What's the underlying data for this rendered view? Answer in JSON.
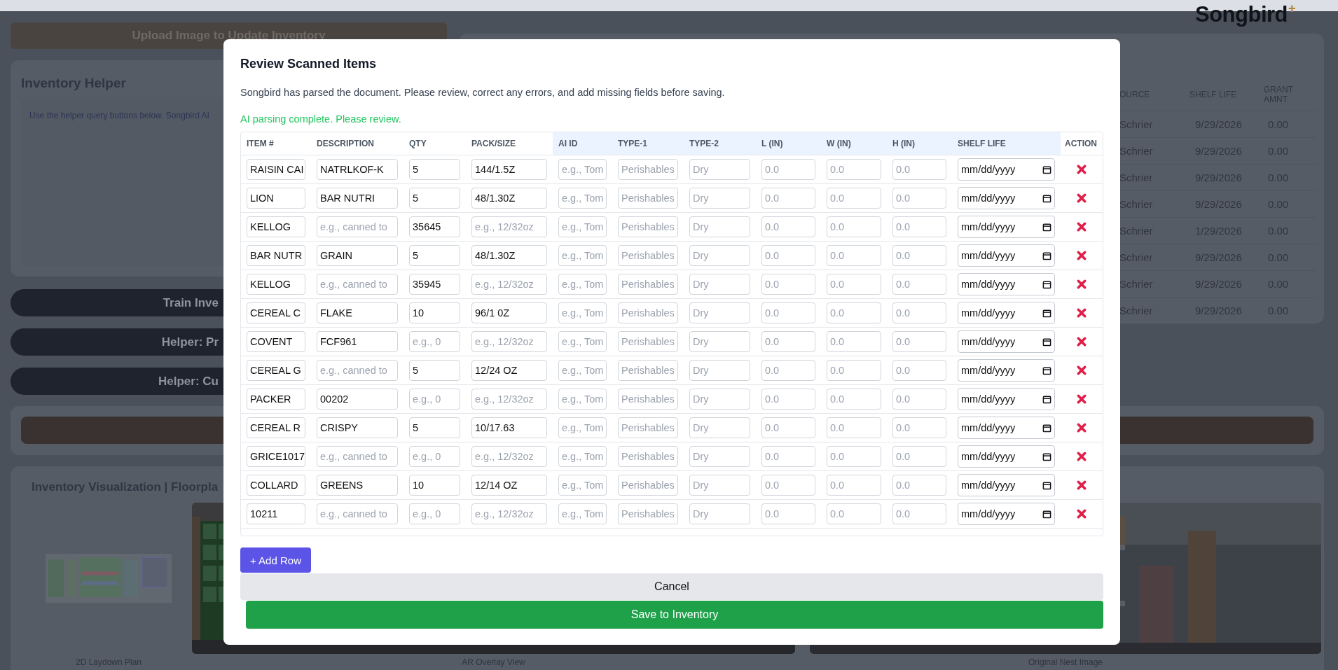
{
  "header": {
    "logo": "Songbird",
    "logo_mark": "+"
  },
  "upload_button": "Upload Image to Update Inventory",
  "helper": {
    "title": "Inventory Helper",
    "text": "Use the helper query buttons below. Songbird AI"
  },
  "helper_buttons": [
    "Train Inve",
    "Helper: Pr",
    "Helper: Cu"
  ],
  "inventory_table": {
    "columns": [
      "OURCE",
      "SHELF LIFE",
      "GRANT AMNT"
    ],
    "rows": [
      [
        "Schrier",
        "9/29/2026",
        "0.00"
      ],
      [
        "Schrier",
        "9/29/2026",
        "0.00"
      ],
      [
        "Schrier",
        "9/29/2026",
        "0.00"
      ],
      [
        "Schrier",
        "9/29/2026",
        "0.00"
      ],
      [
        "Schrier",
        "1/29/2026",
        "0.00"
      ],
      [
        "Schrier",
        "9/29/2026",
        "0.00"
      ],
      [
        "Schrier",
        "9/29/2026",
        "0.00"
      ],
      [
        "Schrier",
        "9/29/2026",
        "0.00"
      ]
    ]
  },
  "visualization": {
    "title": "Inventory Visualization | Floorpla",
    "panels": [
      {
        "kind": "plan",
        "caption": "2D Laydown Plan"
      },
      {
        "kind": "overlay",
        "caption": "AR Overlay View"
      },
      {
        "caption": "Original Nest Image"
      }
    ]
  },
  "modal": {
    "title": "Review Scanned Items",
    "description": "Songbird has parsed the document. Please review, correct any errors, and add missing fields before saving.",
    "status": "AI parsing complete. Please review.",
    "columns": [
      {
        "label": "ITEM #",
        "kind": "text",
        "highlighted": false
      },
      {
        "label": "DESCRIPTION",
        "kind": "text",
        "highlighted": false
      },
      {
        "label": "QTY",
        "kind": "text",
        "highlighted": false
      },
      {
        "label": "PACK/SIZE",
        "kind": "text",
        "highlighted": false
      },
      {
        "label": "AI ID",
        "kind": "text",
        "highlighted": true
      },
      {
        "label": "TYPE-1",
        "kind": "text",
        "highlighted": true
      },
      {
        "label": "TYPE-2",
        "kind": "text",
        "highlighted": true
      },
      {
        "label": "L (IN)",
        "kind": "text",
        "highlighted": true
      },
      {
        "label": "W (IN)",
        "kind": "text",
        "highlighted": true
      },
      {
        "label": "H (IN)",
        "kind": "text",
        "highlighted": true
      },
      {
        "label": "SHELF LIFE",
        "kind": "date",
        "highlighted": true
      },
      {
        "label": "ACTION",
        "kind": "action",
        "highlighted": false
      }
    ],
    "rows": [
      {
        "cells": [
          {
            "value": "RAISIN CAI"
          },
          {
            "value": "NATRLKOF-K"
          },
          {
            "value": "5"
          },
          {
            "value": "144/1.5Z"
          },
          {
            "placeholder": "e.g., Tom"
          },
          {
            "placeholder": "Perishables"
          },
          {
            "placeholder": "Dry"
          },
          {
            "placeholder": "0.0"
          },
          {
            "placeholder": "0.0"
          },
          {
            "placeholder": "0.0"
          },
          {
            "value": "mm/dd/yyyy"
          }
        ]
      },
      {
        "cells": [
          {
            "value": "LION"
          },
          {
            "value": "BAR NUTRI"
          },
          {
            "value": "5"
          },
          {
            "value": "48/1.30Z"
          },
          {
            "placeholder": "e.g., Tom"
          },
          {
            "placeholder": "Perishables"
          },
          {
            "placeholder": "Dry"
          },
          {
            "placeholder": "0.0"
          },
          {
            "placeholder": "0.0"
          },
          {
            "placeholder": "0.0"
          },
          {
            "value": "mm/dd/yyyy"
          }
        ]
      },
      {
        "cells": [
          {
            "value": "KELLOG"
          },
          {
            "placeholder": "e.g., canned to"
          },
          {
            "value": "35645"
          },
          {
            "placeholder": "e.g., 12/32oz"
          },
          {
            "placeholder": "e.g., Tom"
          },
          {
            "placeholder": "Perishables"
          },
          {
            "placeholder": "Dry"
          },
          {
            "placeholder": "0.0"
          },
          {
            "placeholder": "0.0"
          },
          {
            "placeholder": "0.0"
          },
          {
            "value": "mm/dd/yyyy"
          }
        ]
      },
      {
        "cells": [
          {
            "value": "BAR NUTR"
          },
          {
            "value": "GRAIN"
          },
          {
            "value": "5"
          },
          {
            "value": "48/1.30Z"
          },
          {
            "placeholder": "e.g., Tom"
          },
          {
            "placeholder": "Perishables"
          },
          {
            "placeholder": "Dry"
          },
          {
            "placeholder": "0.0"
          },
          {
            "placeholder": "0.0"
          },
          {
            "placeholder": "0.0"
          },
          {
            "value": "mm/dd/yyyy"
          }
        ]
      },
      {
        "cells": [
          {
            "value": "KELLOG"
          },
          {
            "placeholder": "e.g., canned to"
          },
          {
            "value": "35945"
          },
          {
            "placeholder": "e.g., 12/32oz"
          },
          {
            "placeholder": "e.g., Tom"
          },
          {
            "placeholder": "Perishables"
          },
          {
            "placeholder": "Dry"
          },
          {
            "placeholder": "0.0"
          },
          {
            "placeholder": "0.0"
          },
          {
            "placeholder": "0.0"
          },
          {
            "value": "mm/dd/yyyy"
          }
        ]
      },
      {
        "cells": [
          {
            "value": "CEREAL C"
          },
          {
            "value": "FLAKE"
          },
          {
            "value": "10"
          },
          {
            "value": "96/1 0Z"
          },
          {
            "placeholder": "e.g., Tom"
          },
          {
            "placeholder": "Perishables"
          },
          {
            "placeholder": "Dry"
          },
          {
            "placeholder": "0.0"
          },
          {
            "placeholder": "0.0"
          },
          {
            "placeholder": "0.0"
          },
          {
            "value": "mm/dd/yyyy"
          }
        ]
      },
      {
        "cells": [
          {
            "value": "COVENT"
          },
          {
            "value": "FCF961"
          },
          {
            "placeholder": "e.g., 0"
          },
          {
            "placeholder": "e.g., 12/32oz"
          },
          {
            "placeholder": "e.g., Tom"
          },
          {
            "placeholder": "Perishables"
          },
          {
            "placeholder": "Dry"
          },
          {
            "placeholder": "0.0"
          },
          {
            "placeholder": "0.0"
          },
          {
            "placeholder": "0.0"
          },
          {
            "value": "mm/dd/yyyy"
          }
        ]
      },
      {
        "cells": [
          {
            "value": "CEREAL G"
          },
          {
            "placeholder": "e.g., canned to"
          },
          {
            "value": "5"
          },
          {
            "value": "12/24 OZ"
          },
          {
            "placeholder": "e.g., Tom"
          },
          {
            "placeholder": "Perishables"
          },
          {
            "placeholder": "Dry"
          },
          {
            "placeholder": "0.0"
          },
          {
            "placeholder": "0.0"
          },
          {
            "placeholder": "0.0"
          },
          {
            "value": "mm/dd/yyyy"
          }
        ]
      },
      {
        "cells": [
          {
            "value": "PACKER"
          },
          {
            "value": "00202"
          },
          {
            "placeholder": "e.g., 0"
          },
          {
            "placeholder": "e.g., 12/32oz"
          },
          {
            "placeholder": "e.g., Tom"
          },
          {
            "placeholder": "Perishables"
          },
          {
            "placeholder": "Dry"
          },
          {
            "placeholder": "0.0"
          },
          {
            "placeholder": "0.0"
          },
          {
            "placeholder": "0.0"
          },
          {
            "value": "mm/dd/yyyy"
          }
        ]
      },
      {
        "cells": [
          {
            "value": "CEREAL R"
          },
          {
            "value": "CRISPY"
          },
          {
            "value": "5"
          },
          {
            "value": "10/17.63"
          },
          {
            "placeholder": "e.g., Tom"
          },
          {
            "placeholder": "Perishables"
          },
          {
            "placeholder": "Dry"
          },
          {
            "placeholder": "0.0"
          },
          {
            "placeholder": "0.0"
          },
          {
            "placeholder": "0.0"
          },
          {
            "value": "mm/dd/yyyy"
          }
        ]
      },
      {
        "cells": [
          {
            "value": "GRICE1017"
          },
          {
            "placeholder": "e.g., canned to"
          },
          {
            "placeholder": "e.g., 0"
          },
          {
            "placeholder": "e.g., 12/32oz"
          },
          {
            "placeholder": "e.g., Tom"
          },
          {
            "placeholder": "Perishables"
          },
          {
            "placeholder": "Dry"
          },
          {
            "placeholder": "0.0"
          },
          {
            "placeholder": "0.0"
          },
          {
            "placeholder": "0.0"
          },
          {
            "value": "mm/dd/yyyy"
          }
        ]
      },
      {
        "cells": [
          {
            "value": "COLLARD"
          },
          {
            "value": "GREENS"
          },
          {
            "value": "10"
          },
          {
            "value": "12/14 OZ"
          },
          {
            "placeholder": "e.g., Tom"
          },
          {
            "placeholder": "Perishables"
          },
          {
            "placeholder": "Dry"
          },
          {
            "placeholder": "0.0"
          },
          {
            "placeholder": "0.0"
          },
          {
            "placeholder": "0.0"
          },
          {
            "value": "mm/dd/yyyy"
          }
        ]
      },
      {
        "cells": [
          {
            "value": "10211"
          },
          {
            "placeholder": "e.g., canned to"
          },
          {
            "placeholder": "e.g., 0"
          },
          {
            "placeholder": "e.g., 12/32oz"
          },
          {
            "placeholder": "e.g., Tom"
          },
          {
            "placeholder": "Perishables"
          },
          {
            "placeholder": "Dry"
          },
          {
            "placeholder": "0.0"
          },
          {
            "placeholder": "0.0"
          },
          {
            "placeholder": "0.0"
          },
          {
            "value": "mm/dd/yyyy"
          }
        ]
      }
    ],
    "add_row_button": "+ Add Row",
    "cancel_button": "Cancel",
    "save_button": "Save to Inventory"
  }
}
